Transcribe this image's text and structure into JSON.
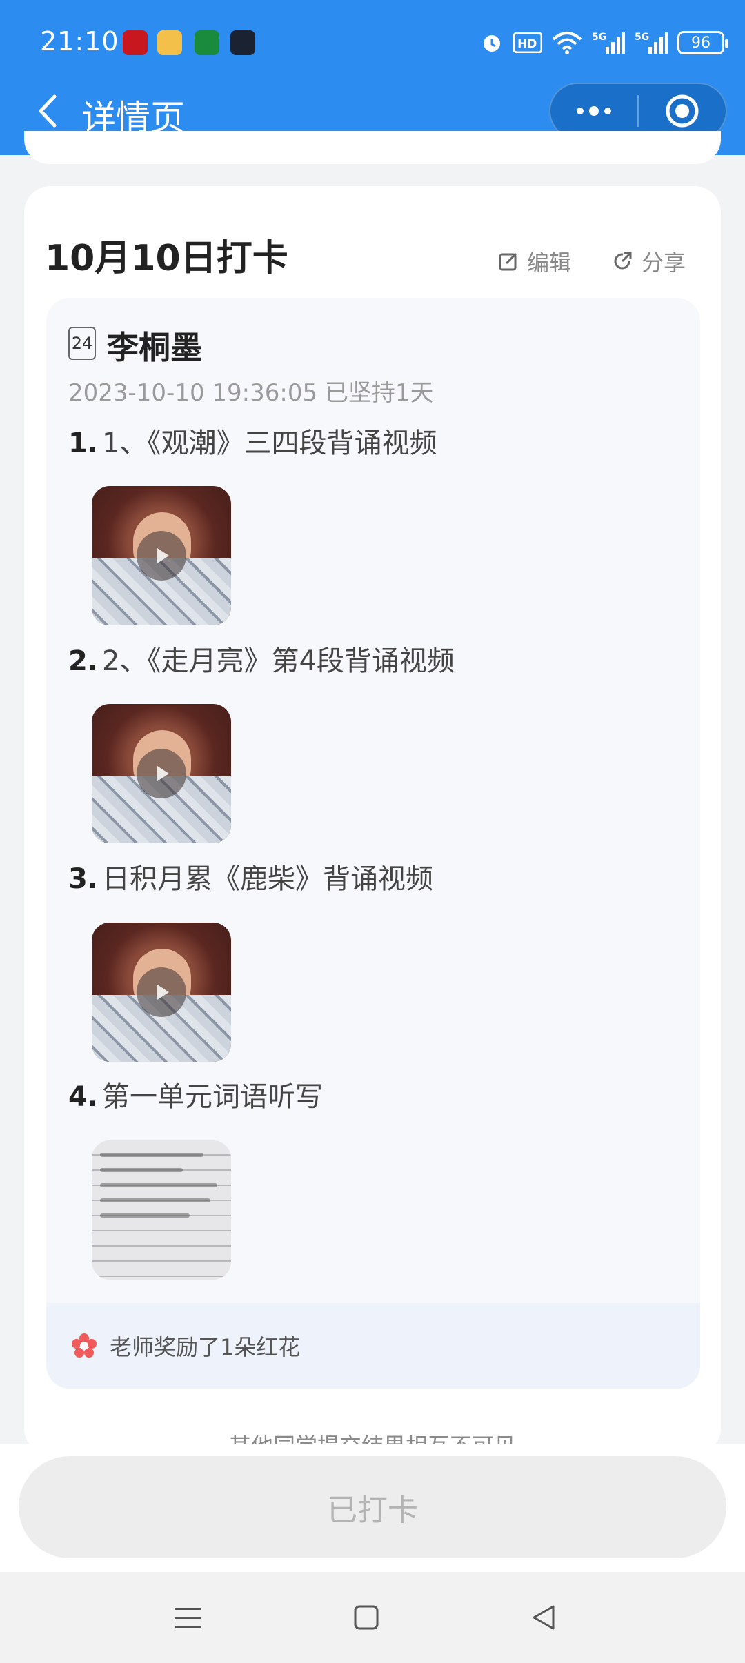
{
  "status_bar": {
    "time": "21:10",
    "battery": "96",
    "icons": [
      "alarm-icon",
      "hd-icon",
      "wifi-icon",
      "signal-5g-icon",
      "signal-5g-icon",
      "battery-icon"
    ],
    "app_icons": [
      "xuexi-app-icon",
      "monkey-app-icon",
      "oppo-app-icon",
      "mail-app-icon"
    ]
  },
  "nav": {
    "title": "详情页",
    "back_icon": "chevron-left-icon",
    "more_icon": "more-dots-icon",
    "close_icon": "target-icon"
  },
  "card": {
    "title": "10月10日打卡",
    "edit_label": "编辑",
    "share_label": "分享",
    "calendar_day": "24",
    "student_name": "李桐墨",
    "meta": "2023-10-10 19:36:05 已坚持1天",
    "tasks": [
      {
        "num": "1.",
        "text": "1、《观潮》三四段背诵视频",
        "media": "video"
      },
      {
        "num": "2.",
        "text": "2、《走月亮》第4段背诵视频",
        "media": "video"
      },
      {
        "num": "3.",
        "text": "日积月累《鹿柴》背诵视频",
        "media": "video"
      },
      {
        "num": "4.",
        "text": "第一单元词语听写",
        "media": "image"
      }
    ],
    "reward_text": "老师奖励了1朵红花"
  },
  "colors": {
    "primary": "#2d8cf0",
    "flower": "#f05a5a"
  },
  "footer_note": "其他同学提交结果相互不可见",
  "checkin_button": "已打卡"
}
